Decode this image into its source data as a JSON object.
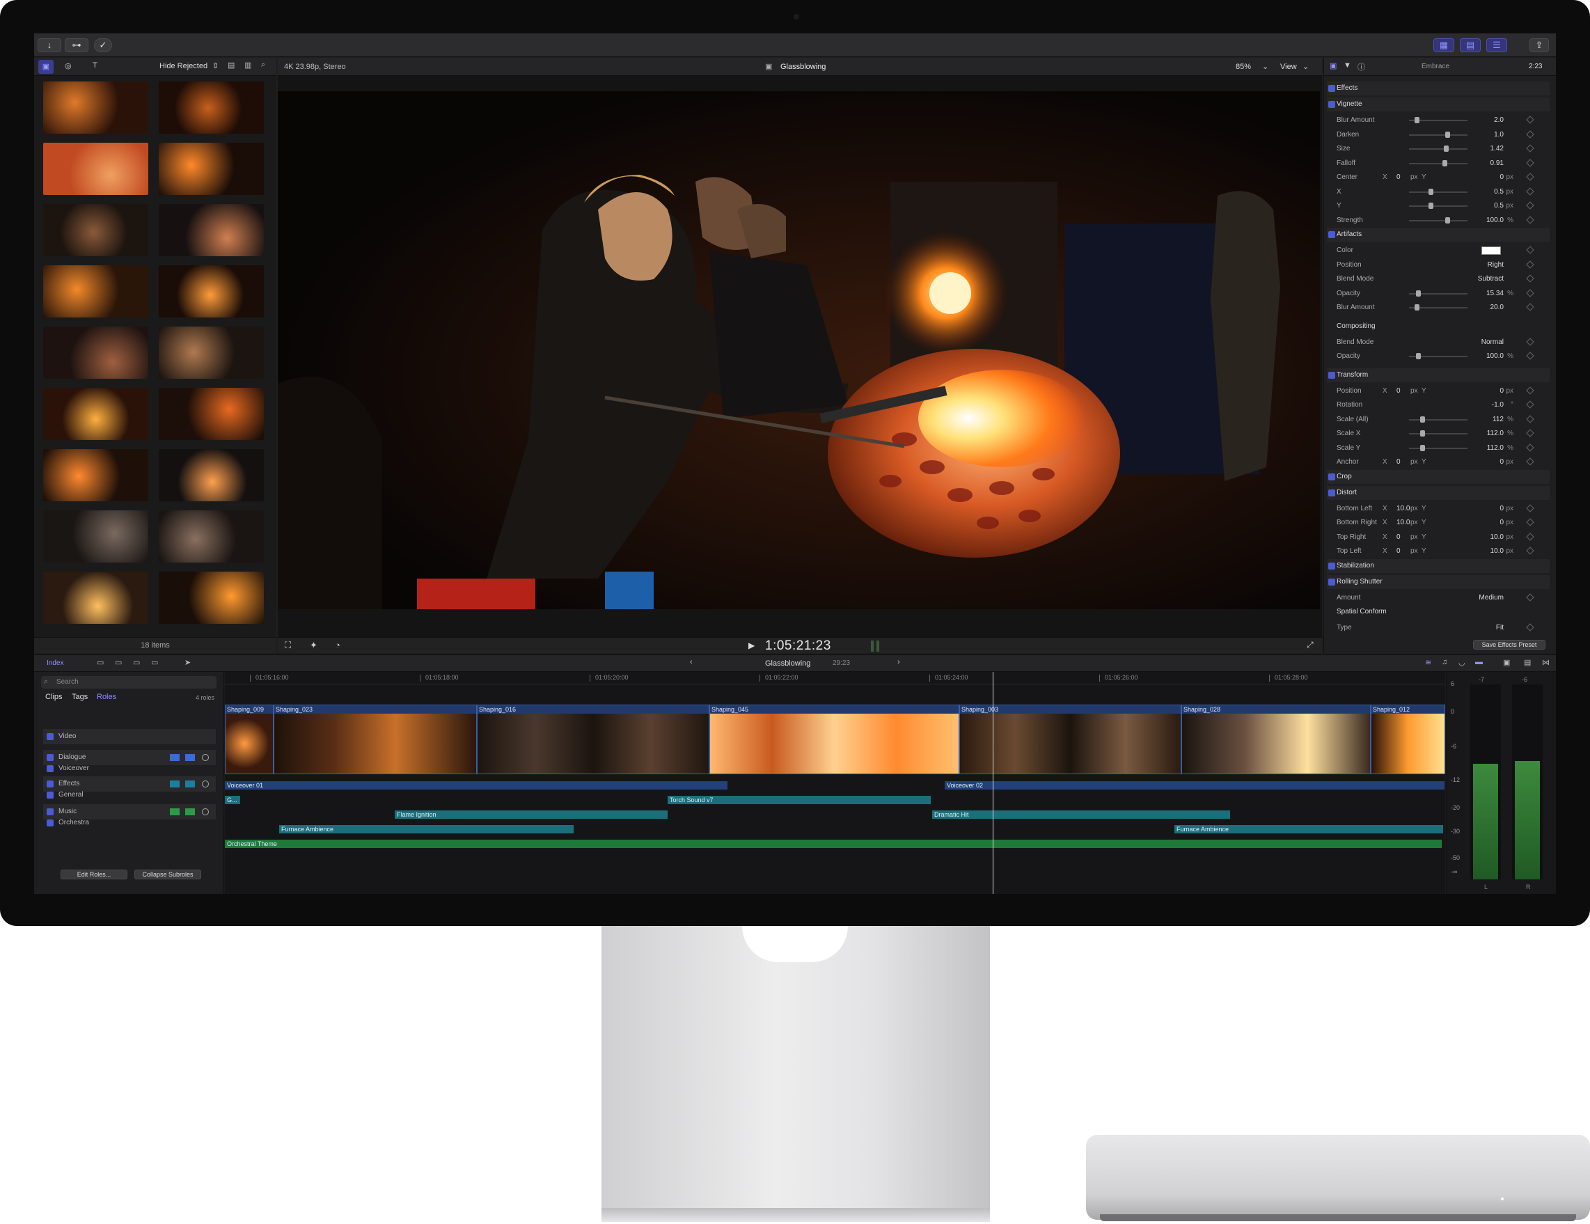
{
  "topbar": {
    "import_icon": "↓",
    "keywords_icon": "⊶",
    "check_icon": "✓",
    "share_icon": "⇪"
  },
  "browser": {
    "filter_label": "Hide Rejected",
    "items_count": "18 items"
  },
  "viewer": {
    "format": "4K 23.98p, Stereo",
    "project_name": "Glassblowing",
    "zoom": "85%",
    "view_label": "View",
    "timecode": "1:05:21:23"
  },
  "inspector": {
    "preset_name": "Embrace",
    "duration": "2:23",
    "rows": [
      {
        "label": "Effects",
        "type": "section"
      },
      {
        "label": "Vignette",
        "type": "section"
      },
      {
        "label": "Blur Amount",
        "value": "2.0"
      },
      {
        "label": "Darken",
        "value": "1.0"
      },
      {
        "label": "Size",
        "value": "1.42"
      },
      {
        "label": "Falloff",
        "value": "0.91"
      },
      {
        "label": "Center",
        "value": "0",
        "unit": "px",
        "xy": "X",
        "value2": "0",
        "unit2": "px"
      },
      {
        "label": "X",
        "value": "0.5",
        "unit": "px"
      },
      {
        "label": "Y",
        "value": "0.5",
        "unit": "px"
      },
      {
        "label": "Strength",
        "value": "100.0",
        "unit": "%"
      },
      {
        "label": "Artifacts",
        "type": "section"
      },
      {
        "label": "Color",
        "value": ""
      },
      {
        "label": "Position",
        "value": "Right"
      },
      {
        "label": "Blend Mode",
        "value": "Subtract"
      },
      {
        "label": "Opacity",
        "value": "15.34",
        "unit": "%"
      },
      {
        "label": "Blur Amount",
        "value": "20.0"
      },
      {
        "label": "Compositing",
        "type": "header"
      },
      {
        "label": "Blend Mode",
        "value": "Normal"
      },
      {
        "label": "Opacity",
        "value": "100.0",
        "unit": "%"
      },
      {
        "label": "Transform",
        "type": "section"
      },
      {
        "label": "Position",
        "value": "0",
        "unit": "px",
        "xy": "X",
        "value2": "0",
        "unit2": "px"
      },
      {
        "label": "Rotation",
        "value": "-1.0",
        "unit": "°"
      },
      {
        "label": "Scale (All)",
        "value": "112",
        "unit": "%"
      },
      {
        "label": "Scale X",
        "value": "112.0",
        "unit": "%"
      },
      {
        "label": "Scale Y",
        "value": "112.0",
        "unit": "%"
      },
      {
        "label": "Anchor",
        "value": "0",
        "unit": "px",
        "xy": "X",
        "value2": "0",
        "unit2": "px"
      },
      {
        "label": "Crop",
        "type": "section"
      },
      {
        "label": "Distort",
        "type": "section"
      },
      {
        "label": "Bottom Left",
        "value": "10.0",
        "unit": "px",
        "xy": "X",
        "value2": "0",
        "unit2": "px"
      },
      {
        "label": "Bottom Right",
        "value": "10.0",
        "unit": "px",
        "xy": "X",
        "value2": "0",
        "unit2": "px"
      },
      {
        "label": "Top Right",
        "value": "0",
        "unit": "px",
        "xy": "X",
        "value2": "10.0",
        "unit2": "px"
      },
      {
        "label": "Top Left",
        "value": "0",
        "unit": "px",
        "xy": "X",
        "value2": "10.0",
        "unit2": "px"
      },
      {
        "label": "Stabilization",
        "type": "section"
      },
      {
        "label": "Rolling Shutter",
        "type": "section"
      },
      {
        "label": "Amount",
        "value": "Medium"
      },
      {
        "label": "Spatial Conform",
        "type": "header"
      },
      {
        "label": "Type",
        "value": "Fit"
      }
    ],
    "save_preset": "Save Effects Preset"
  },
  "timeline": {
    "index_label": "Index",
    "project_name": "Glassblowing",
    "duration": "29:23",
    "search_placeholder": "Search",
    "tabs": [
      "Clips",
      "Tags",
      "Roles"
    ],
    "roles_count": "4 roles",
    "roles": [
      "Video",
      "Dialogue",
      "Voiceover",
      "Effects",
      "General",
      "Music",
      "Orchestra"
    ],
    "edit_roles": "Edit Roles...",
    "collapse_subroles": "Collapse Subroles",
    "ruler": [
      "01:05:16:00",
      "01:05:18:00",
      "01:05:20:00",
      "01:05:22:00",
      "01:05:24:00",
      "01:05:26:00",
      "01:05:28:00"
    ],
    "video_clips": [
      "Shaping_009",
      "Shaping_023",
      "Shaping_016",
      "Shaping_045",
      "Shaping_003",
      "Shaping_028",
      "Shaping_012"
    ],
    "audio_clips": [
      "Voiceover 01",
      "Voiceover 02",
      "G...",
      "Torch Sound v7",
      "Flame Ignition",
      "Dramatic Hit",
      "Furnace Ambience",
      "Furnace Ambience",
      "Orchestral Theme"
    ],
    "meter_scale": [
      "6",
      "0",
      "-6",
      "-12",
      "-20",
      "-30",
      "-50",
      "-∞"
    ],
    "meter_peaks": [
      "-7",
      "-6"
    ],
    "meter_channels": [
      "L",
      "R"
    ]
  }
}
